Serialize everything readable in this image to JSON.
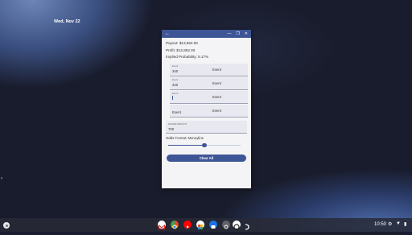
{
  "desktop": {
    "date": "Wed, Nov 22"
  },
  "window": {
    "controls": {
      "back": "←",
      "minimize": "—",
      "maximize": "❐",
      "close": "✕"
    },
    "payout": "Payout: $13,552.00",
    "profit": "Profit: $12,852.00",
    "implied": "Implied Probability: 5.17%",
    "events": [
      {
        "label": "Event",
        "odds": "340",
        "name": "Event"
      },
      {
        "label": "Event",
        "odds": "340",
        "name": "Event"
      },
      {
        "label": "Event",
        "odds": "",
        "name": "Event"
      },
      {
        "label": "",
        "odds": "Event",
        "name": "Event"
      }
    ],
    "wager": {
      "label": "WAGER AMOUNT",
      "value": "700"
    },
    "odds_format": "Odds Format: Moneyline",
    "slider_value": 0.5,
    "clear_button": "Clear All"
  },
  "shelf": {
    "apps": [
      "gmail-icon",
      "chrome-icon",
      "youtube-icon",
      "photos-icon",
      "files-icon",
      "camera-icon",
      "app-icon",
      "play-icon"
    ],
    "time": "10:50",
    "status_icons": [
      "settings-icon",
      "wifi-icon",
      "battery-icon"
    ]
  }
}
